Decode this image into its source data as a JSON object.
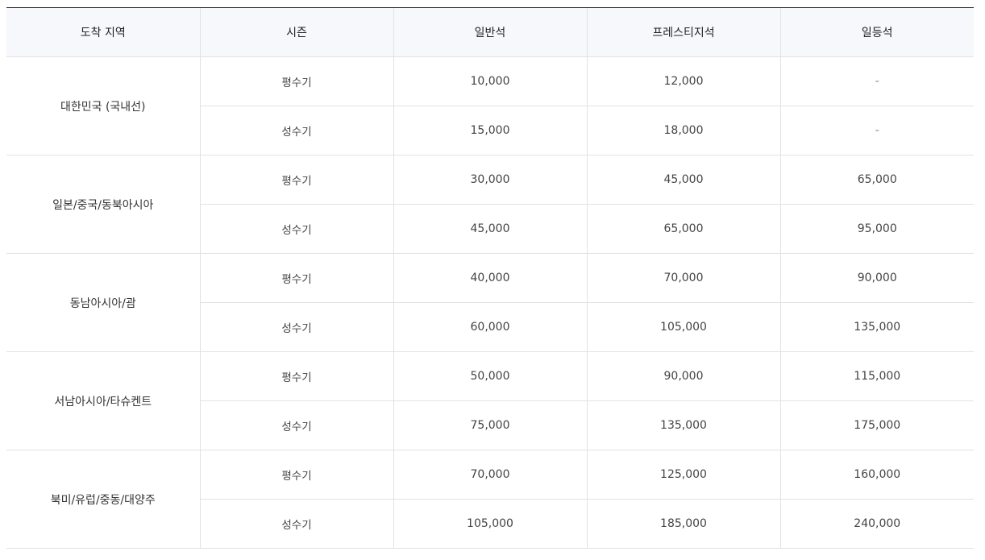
{
  "headers": [
    "도착 지역",
    "시즌",
    "일반석",
    "프레스티지석",
    "일등석"
  ],
  "regions": [
    {
      "name": "대한민국 (국내선)",
      "rows": [
        {
          "season": "평수기",
          "economy": "10,000",
          "prestige": "12,000",
          "first": "-"
        },
        {
          "season": "성수기",
          "economy": "15,000",
          "prestige": "18,000",
          "first": "-"
        }
      ]
    },
    {
      "name": "일본/중국/동북아시아",
      "rows": [
        {
          "season": "평수기",
          "economy": "30,000",
          "prestige": "45,000",
          "first": "65,000"
        },
        {
          "season": "성수기",
          "economy": "45,000",
          "prestige": "65,000",
          "first": "95,000"
        }
      ]
    },
    {
      "name": "동남아시아/괌",
      "rows": [
        {
          "season": "평수기",
          "economy": "40,000",
          "prestige": "70,000",
          "first": "90,000"
        },
        {
          "season": "성수기",
          "economy": "60,000",
          "prestige": "105,000",
          "first": "135,000"
        }
      ]
    },
    {
      "name": "서남아시아/타슈켄트",
      "rows": [
        {
          "season": "평수기",
          "economy": "50,000",
          "prestige": "90,000",
          "first": "115,000"
        },
        {
          "season": "성수기",
          "economy": "75,000",
          "prestige": "135,000",
          "first": "175,000"
        }
      ]
    },
    {
      "name": "북미/유럽/중동/대양주",
      "rows": [
        {
          "season": "평수기",
          "economy": "70,000",
          "prestige": "125,000",
          "first": "160,000"
        },
        {
          "season": "성수기",
          "economy": "105,000",
          "prestige": "185,000",
          "first": "240,000"
        }
      ]
    }
  ]
}
